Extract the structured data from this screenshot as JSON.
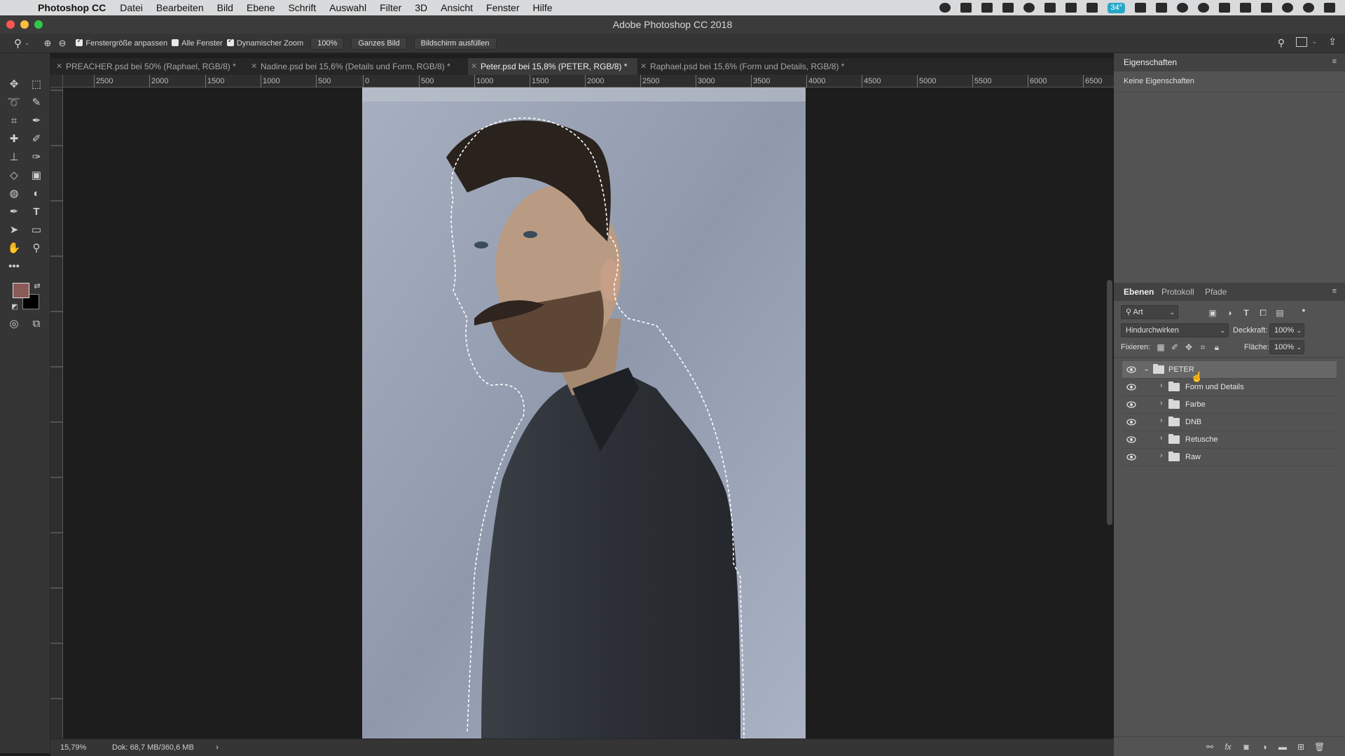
{
  "menubar": {
    "app_name": "Photoshop CC",
    "items": [
      "Datei",
      "Bearbeiten",
      "Bild",
      "Ebene",
      "Schrift",
      "Auswahl",
      "Filter",
      "3D",
      "Ansicht",
      "Fenster",
      "Hilfe"
    ],
    "battery_badge": "34°"
  },
  "window": {
    "title": "Adobe Photoshop CC 2018"
  },
  "options": {
    "fit_window_label": "Fenstergröße anpassen",
    "fit_window_checked": true,
    "all_windows_label": "Alle Fenster",
    "all_windows_checked": false,
    "dynamic_zoom_label": "Dynamischer Zoom",
    "dynamic_zoom_checked": true,
    "zoom_value": "100%",
    "fit_screen_label": "Ganzes Bild",
    "fill_screen_label": "Bildschirm ausfüllen"
  },
  "tabs": [
    {
      "label": "PREACHER.psd bei 50% (Raphael, RGB/8) *",
      "active": false
    },
    {
      "label": "Nadine.psd bei 15,6% (Details und Form, RGB/8) *",
      "active": false
    },
    {
      "label": "Peter.psd bei 15,8% (PETER, RGB/8) *",
      "active": true
    },
    {
      "label": "Raphael.psd bei 15,6% (Form und Details, RGB/8) *",
      "active": false
    }
  ],
  "ruler": {
    "ticks": [
      "2500",
      "2000",
      "1500",
      "1000",
      "500",
      "0",
      "500",
      "1000",
      "1500",
      "2000",
      "2500",
      "3000",
      "3500",
      "4000",
      "4500",
      "5000",
      "5500",
      "6000",
      "6500"
    ]
  },
  "statusbar": {
    "zoom": "15,79%",
    "doc_info": "Dok: 68,7 MB/360,6 MB"
  },
  "properties": {
    "title": "Eigenschaften",
    "empty_text": "Keine Eigenschaften"
  },
  "layers_panel": {
    "tabs": [
      "Ebenen",
      "Protokoll",
      "Pfade"
    ],
    "filter_label": "Art",
    "blend_mode": "Hindurchwirken",
    "opacity_label": "Deckkraft:",
    "opacity_value": "100%",
    "lock_label": "Fixieren:",
    "fill_label": "Fläche:",
    "fill_value": "100%",
    "layers": [
      {
        "name": "PETER",
        "expanded": true,
        "selected": true
      },
      {
        "name": "Form und Details",
        "expanded": false,
        "selected": false
      },
      {
        "name": "Farbe",
        "expanded": false,
        "selected": false
      },
      {
        "name": "DNB",
        "expanded": false,
        "selected": false
      },
      {
        "name": "Retusche",
        "expanded": false,
        "selected": false
      },
      {
        "name": "Raw",
        "expanded": false,
        "selected": false
      }
    ]
  },
  "colors": {
    "foreground": "#8a5a57",
    "background": "#000000",
    "selection_ants": "#ffffff"
  },
  "icons": {
    "tools": [
      "move-icon",
      "marquee-icon",
      "lasso-icon",
      "quick-selection-icon",
      "crop-icon",
      "eyedropper-icon",
      "healing-brush-icon",
      "brush-icon",
      "stamp-icon",
      "history-brush-icon",
      "eraser-icon",
      "gradient-icon",
      "blur-icon",
      "dodge-icon",
      "pen-icon",
      "type-icon",
      "path-selection-icon",
      "rectangle-icon",
      "hand-icon",
      "zoom-icon"
    ]
  }
}
